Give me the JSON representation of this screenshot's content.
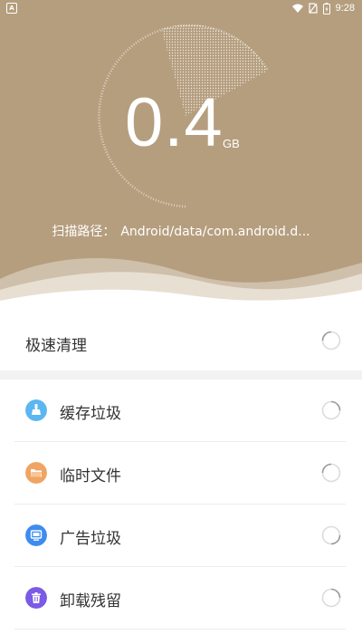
{
  "status_bar": {
    "left_icon": "A",
    "time": "9:28",
    "icons": [
      "wifi-icon",
      "no-sim-icon",
      "battery-icon"
    ]
  },
  "scan": {
    "value": "0.4",
    "unit": "GB",
    "path_label": "扫描路径：",
    "path_value": "Android/data/com.android.d..."
  },
  "quick_clean": {
    "label": "极速清理"
  },
  "categories": [
    {
      "label": "缓存垃圾",
      "icon": "broom-icon",
      "color": "#5bb6f2"
    },
    {
      "label": "临时文件",
      "icon": "folder-icon",
      "color": "#f0a463"
    },
    {
      "label": "广告垃圾",
      "icon": "monitor-icon",
      "color": "#3f8cf0"
    },
    {
      "label": "卸载残留",
      "icon": "trash-icon",
      "color": "#7b5ae6"
    }
  ],
  "colors": {
    "hero_bg": "#b59e7e",
    "wave_light": "#e8dfd3",
    "text_dark": "#333333"
  }
}
